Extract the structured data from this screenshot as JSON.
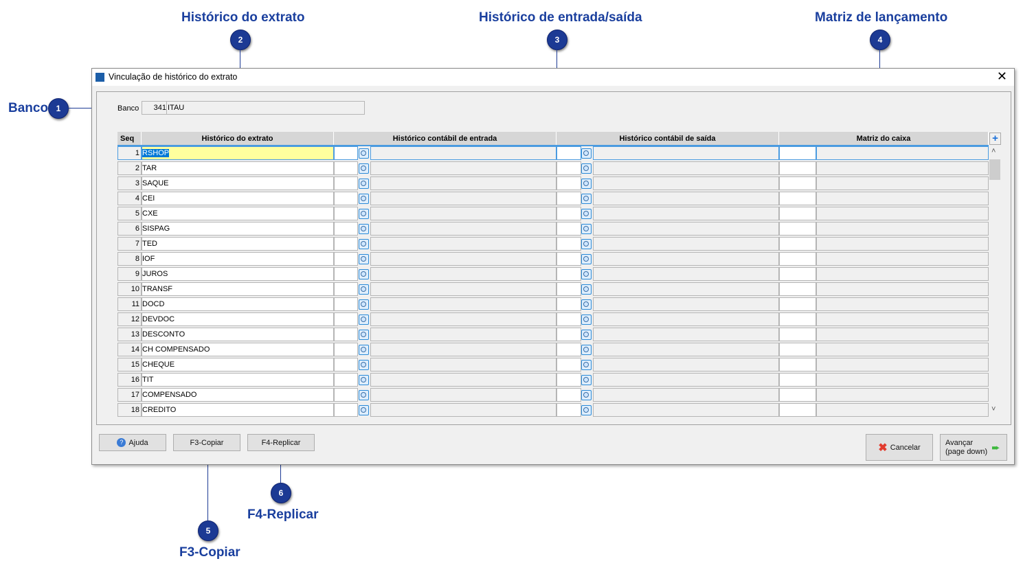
{
  "callouts": [
    {
      "num": "1",
      "title": "Banco"
    },
    {
      "num": "2",
      "title": "Histórico do extrato"
    },
    {
      "num": "3",
      "title": "Histórico de entrada/saída"
    },
    {
      "num": "4",
      "title": "Matriz de lançamento"
    },
    {
      "num": "5",
      "title": "F3-Copiar"
    },
    {
      "num": "6",
      "title": "F4-Replicar"
    }
  ],
  "window": {
    "title": "Vinculação de histórico do extrato"
  },
  "banco": {
    "label": "Banco",
    "code": "341",
    "name": "ITAU"
  },
  "table": {
    "headers": [
      "Seq",
      "Histórico do extrato",
      "Histórico contábil de entrada",
      "Histórico contábil de saída",
      "Matriz do caixa"
    ],
    "rows": [
      {
        "seq": "1",
        "hist": "RSHOP"
      },
      {
        "seq": "2",
        "hist": "TAR"
      },
      {
        "seq": "3",
        "hist": "SAQUE"
      },
      {
        "seq": "4",
        "hist": "CEI"
      },
      {
        "seq": "5",
        "hist": "CXE"
      },
      {
        "seq": "6",
        "hist": "SISPAG"
      },
      {
        "seq": "7",
        "hist": "TED"
      },
      {
        "seq": "8",
        "hist": "IOF"
      },
      {
        "seq": "9",
        "hist": "JUROS"
      },
      {
        "seq": "10",
        "hist": "TRANSF"
      },
      {
        "seq": "11",
        "hist": "DOCD"
      },
      {
        "seq": "12",
        "hist": "DEVDOC"
      },
      {
        "seq": "13",
        "hist": "DESCONTO"
      },
      {
        "seq": "14",
        "hist": "CH COMPENSADO"
      },
      {
        "seq": "15",
        "hist": "CHEQUE"
      },
      {
        "seq": "16",
        "hist": "TIT"
      },
      {
        "seq": "17",
        "hist": "COMPENSADO"
      },
      {
        "seq": "18",
        "hist": "CREDITO"
      }
    ]
  },
  "buttons": {
    "ajuda": "Ajuda",
    "copiar": "F3-Copiar",
    "replicar": "F4-Replicar",
    "cancelar": "Cancelar",
    "avancar1": "Avançar",
    "avancar2": "(page down)"
  },
  "colors": {
    "accent": "#1c3a94",
    "selected_row": "#ffff9e",
    "selection": "#0078d7"
  }
}
